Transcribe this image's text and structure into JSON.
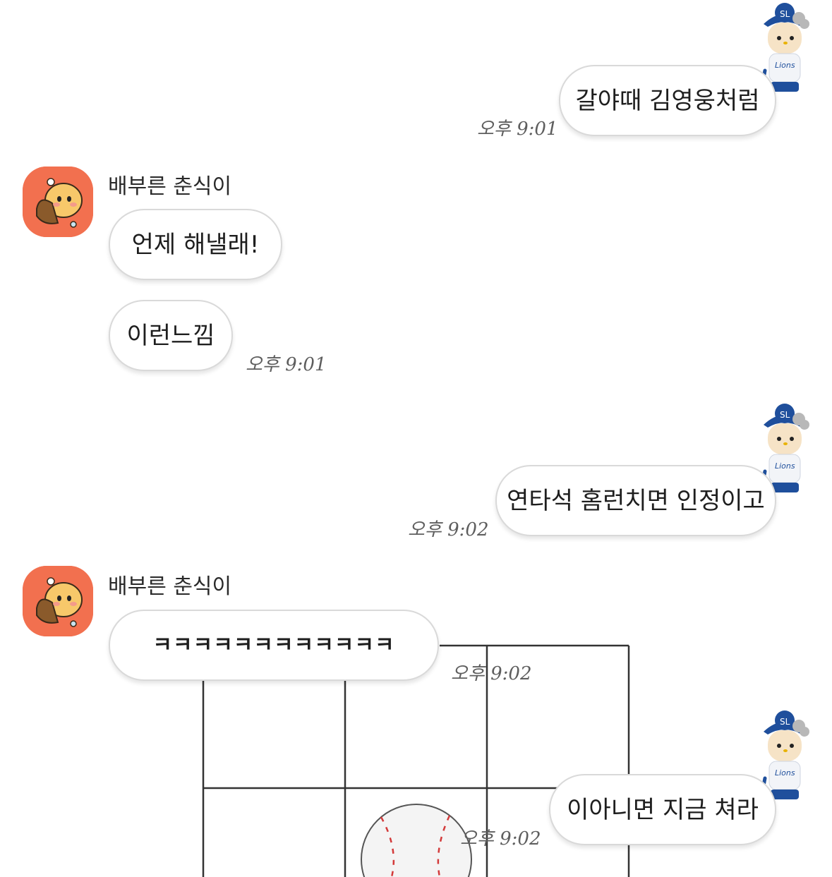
{
  "friend": {
    "name": "배부른 춘식이"
  },
  "messages": [
    {
      "id": "m1",
      "side": "me",
      "text": "갈야때 김영웅처럼",
      "time": "오후 9:01"
    },
    {
      "id": "m2",
      "side": "friend",
      "text": "언제 해낼래!",
      "time": ""
    },
    {
      "id": "m3",
      "side": "friend",
      "text": "이런느낌",
      "time": "오후 9:01"
    },
    {
      "id": "m4",
      "side": "me",
      "text": "연타석 홈런치면 인정이고",
      "time": "오후 9:02"
    },
    {
      "id": "m5",
      "side": "friend",
      "text": "ㅋㅋㅋㅋㅋㅋㅋㅋㅋㅋㅋㅋ",
      "time": "오후 9:02"
    },
    {
      "id": "m6",
      "side": "me",
      "text": "이아니면 지금 쳐라",
      "time": "오후 9:02"
    }
  ],
  "my_avatar": {
    "cap_logo": "SL",
    "jersey_text": "Lions"
  },
  "colors": {
    "friend_avatar_bg": "#f2704f",
    "my_cap": "#1f4f9c",
    "ball_stitch": "#d33a3a"
  },
  "icons": {
    "friend_avatar": "choonsik-character-icon",
    "my_avatar": "hello-kitty-lions-icon",
    "sticker": "strike-zone-baseball-sticker"
  }
}
